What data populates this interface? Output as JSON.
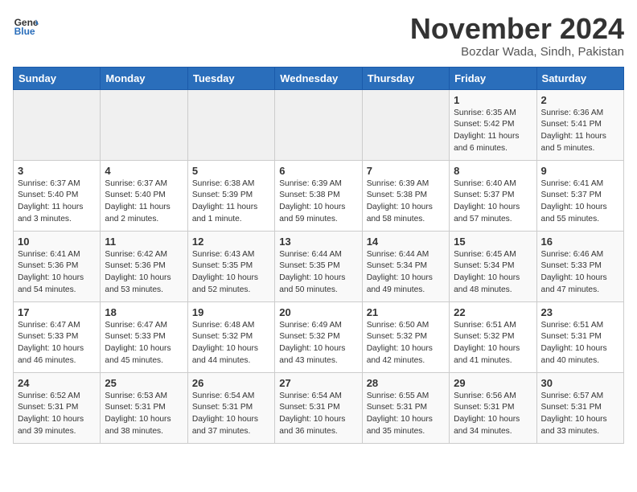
{
  "header": {
    "logo_general": "General",
    "logo_blue": "Blue",
    "month_title": "November 2024",
    "subtitle": "Bozdar Wada, Sindh, Pakistan"
  },
  "days_of_week": [
    "Sunday",
    "Monday",
    "Tuesday",
    "Wednesday",
    "Thursday",
    "Friday",
    "Saturday"
  ],
  "weeks": [
    [
      {
        "day": "",
        "info": ""
      },
      {
        "day": "",
        "info": ""
      },
      {
        "day": "",
        "info": ""
      },
      {
        "day": "",
        "info": ""
      },
      {
        "day": "",
        "info": ""
      },
      {
        "day": "1",
        "info": "Sunrise: 6:35 AM\nSunset: 5:42 PM\nDaylight: 11 hours and 6 minutes."
      },
      {
        "day": "2",
        "info": "Sunrise: 6:36 AM\nSunset: 5:41 PM\nDaylight: 11 hours and 5 minutes."
      }
    ],
    [
      {
        "day": "3",
        "info": "Sunrise: 6:37 AM\nSunset: 5:40 PM\nDaylight: 11 hours and 3 minutes."
      },
      {
        "day": "4",
        "info": "Sunrise: 6:37 AM\nSunset: 5:40 PM\nDaylight: 11 hours and 2 minutes."
      },
      {
        "day": "5",
        "info": "Sunrise: 6:38 AM\nSunset: 5:39 PM\nDaylight: 11 hours and 1 minute."
      },
      {
        "day": "6",
        "info": "Sunrise: 6:39 AM\nSunset: 5:38 PM\nDaylight: 10 hours and 59 minutes."
      },
      {
        "day": "7",
        "info": "Sunrise: 6:39 AM\nSunset: 5:38 PM\nDaylight: 10 hours and 58 minutes."
      },
      {
        "day": "8",
        "info": "Sunrise: 6:40 AM\nSunset: 5:37 PM\nDaylight: 10 hours and 57 minutes."
      },
      {
        "day": "9",
        "info": "Sunrise: 6:41 AM\nSunset: 5:37 PM\nDaylight: 10 hours and 55 minutes."
      }
    ],
    [
      {
        "day": "10",
        "info": "Sunrise: 6:41 AM\nSunset: 5:36 PM\nDaylight: 10 hours and 54 minutes."
      },
      {
        "day": "11",
        "info": "Sunrise: 6:42 AM\nSunset: 5:36 PM\nDaylight: 10 hours and 53 minutes."
      },
      {
        "day": "12",
        "info": "Sunrise: 6:43 AM\nSunset: 5:35 PM\nDaylight: 10 hours and 52 minutes."
      },
      {
        "day": "13",
        "info": "Sunrise: 6:44 AM\nSunset: 5:35 PM\nDaylight: 10 hours and 50 minutes."
      },
      {
        "day": "14",
        "info": "Sunrise: 6:44 AM\nSunset: 5:34 PM\nDaylight: 10 hours and 49 minutes."
      },
      {
        "day": "15",
        "info": "Sunrise: 6:45 AM\nSunset: 5:34 PM\nDaylight: 10 hours and 48 minutes."
      },
      {
        "day": "16",
        "info": "Sunrise: 6:46 AM\nSunset: 5:33 PM\nDaylight: 10 hours and 47 minutes."
      }
    ],
    [
      {
        "day": "17",
        "info": "Sunrise: 6:47 AM\nSunset: 5:33 PM\nDaylight: 10 hours and 46 minutes."
      },
      {
        "day": "18",
        "info": "Sunrise: 6:47 AM\nSunset: 5:33 PM\nDaylight: 10 hours and 45 minutes."
      },
      {
        "day": "19",
        "info": "Sunrise: 6:48 AM\nSunset: 5:32 PM\nDaylight: 10 hours and 44 minutes."
      },
      {
        "day": "20",
        "info": "Sunrise: 6:49 AM\nSunset: 5:32 PM\nDaylight: 10 hours and 43 minutes."
      },
      {
        "day": "21",
        "info": "Sunrise: 6:50 AM\nSunset: 5:32 PM\nDaylight: 10 hours and 42 minutes."
      },
      {
        "day": "22",
        "info": "Sunrise: 6:51 AM\nSunset: 5:32 PM\nDaylight: 10 hours and 41 minutes."
      },
      {
        "day": "23",
        "info": "Sunrise: 6:51 AM\nSunset: 5:31 PM\nDaylight: 10 hours and 40 minutes."
      }
    ],
    [
      {
        "day": "24",
        "info": "Sunrise: 6:52 AM\nSunset: 5:31 PM\nDaylight: 10 hours and 39 minutes."
      },
      {
        "day": "25",
        "info": "Sunrise: 6:53 AM\nSunset: 5:31 PM\nDaylight: 10 hours and 38 minutes."
      },
      {
        "day": "26",
        "info": "Sunrise: 6:54 AM\nSunset: 5:31 PM\nDaylight: 10 hours and 37 minutes."
      },
      {
        "day": "27",
        "info": "Sunrise: 6:54 AM\nSunset: 5:31 PM\nDaylight: 10 hours and 36 minutes."
      },
      {
        "day": "28",
        "info": "Sunrise: 6:55 AM\nSunset: 5:31 PM\nDaylight: 10 hours and 35 minutes."
      },
      {
        "day": "29",
        "info": "Sunrise: 6:56 AM\nSunset: 5:31 PM\nDaylight: 10 hours and 34 minutes."
      },
      {
        "day": "30",
        "info": "Sunrise: 6:57 AM\nSunset: 5:31 PM\nDaylight: 10 hours and 33 minutes."
      }
    ]
  ]
}
